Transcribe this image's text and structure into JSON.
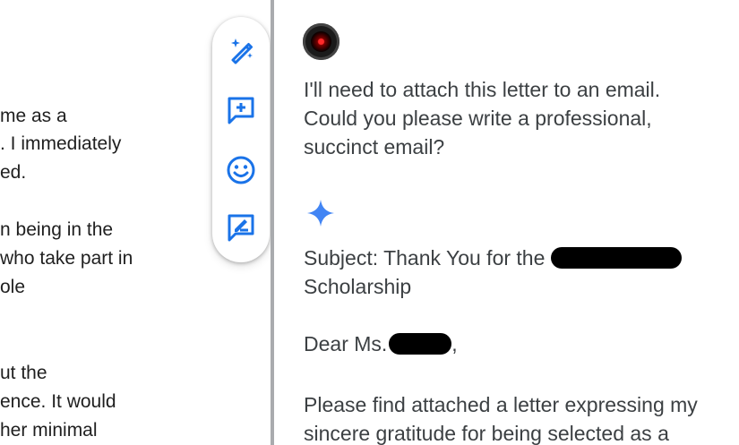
{
  "document": {
    "lines": [
      "me as a",
      ". I immediately",
      "ed.",
      "n being in the",
      "who take part in",
      "ole",
      "ut the",
      "ence. It would",
      "her minimal"
    ]
  },
  "side_toolbar": {
    "tools": [
      {
        "icon": "magic-pen-icon"
      },
      {
        "icon": "add-comment-icon"
      },
      {
        "icon": "emoji-icon"
      },
      {
        "icon": "suggest-edit-icon"
      }
    ],
    "accent": "#1a73e8"
  },
  "chat": {
    "user_prompt": {
      "lines": [
        "I'll need to attach this letter to an email.",
        "Could you please write a professional,",
        "succinct email?"
      ]
    },
    "response": {
      "icon": "sparkle-icon",
      "subject_prefix": "Subject: Thank You for the",
      "subject_suffix": "Scholarship",
      "greeting_prefix": "Dear Ms.",
      "greeting_suffix": ",",
      "body_lines": [
        "Please find attached a letter expressing my",
        "sincere gratitude for being selected as a"
      ]
    }
  }
}
